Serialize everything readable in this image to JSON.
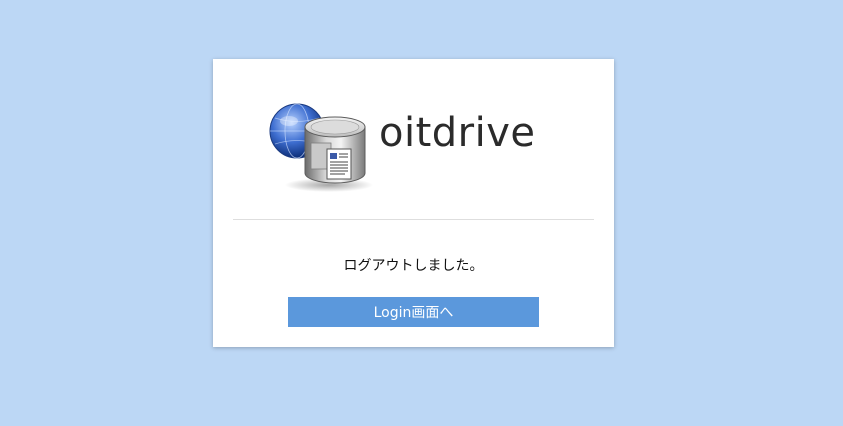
{
  "brand": {
    "name": "oitdrive",
    "logo_icon": "globe-database-document-icon"
  },
  "logout": {
    "message": "ログアウトしました。",
    "login_button_label": "Login画面へ"
  },
  "colors": {
    "background": "#bcd7f5",
    "card": "#ffffff",
    "button": "#5b98dc",
    "button_text": "#ffffff"
  }
}
